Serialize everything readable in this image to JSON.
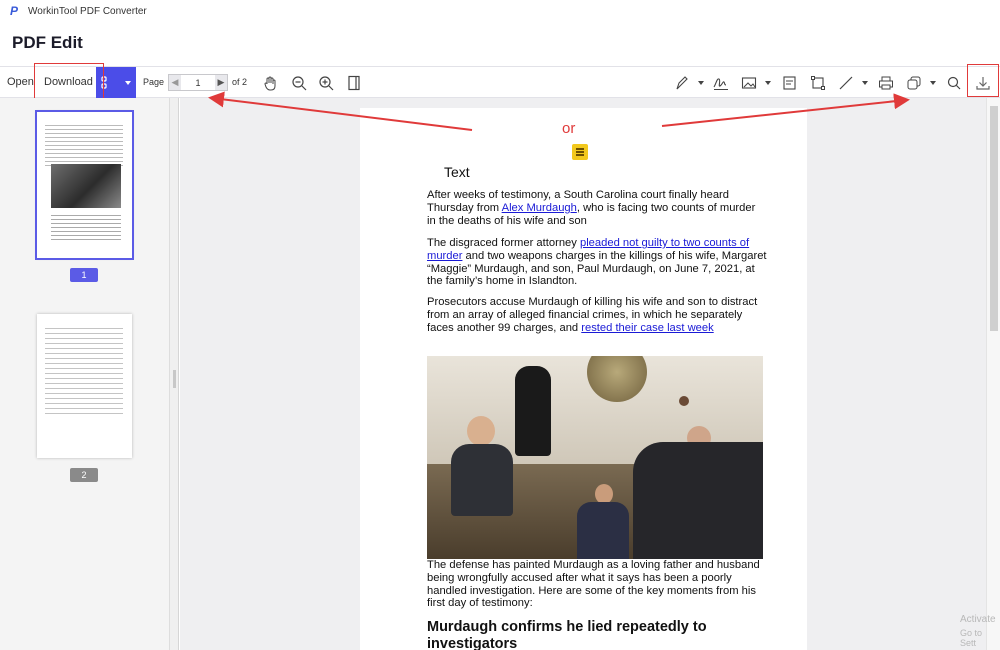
{
  "app": {
    "title": "WorkinTool PDF Converter"
  },
  "header": {
    "title": "PDF Edit"
  },
  "toolbar": {
    "open_label": "Open",
    "download_label": "Download",
    "page_label": "Page",
    "page_value": "1",
    "page_total": "of 2",
    "icons": [
      "hand-icon",
      "zoom-out-icon",
      "zoom-in-icon",
      "single-page-icon",
      "pen-icon",
      "signature-icon",
      "image-icon",
      "form-icon",
      "crop-icon",
      "line-icon",
      "print-icon",
      "stamp-icon",
      "search-icon",
      "download-icon"
    ]
  },
  "annotation": {
    "or_label": "or",
    "accent_color": "#e03a3a"
  },
  "sidebar": {
    "pages": [
      {
        "number": "1",
        "selected": true
      },
      {
        "number": "2",
        "selected": false
      }
    ]
  },
  "document": {
    "text_label": "Text",
    "para1_a": "After weeks of testimony, a South Carolina court finally heard Thursday from ",
    "para1_link": "Alex Murdaugh",
    "para1_b": ", who is facing two counts of murder in the deaths of his wife and son",
    "para2_a": "The disgraced former attorney ",
    "para2_link": "pleaded not guilty to two counts of murder",
    "para2_b": " and two weapons charges in the killings of his wife, Margaret “Maggie” Murdaugh, and son, Paul Murdaugh, on June 7, 2021, at the family’s home in Islandton.",
    "para3_a": "Prosecutors accuse Murdaugh of killing his wife and son to distract from an array of alleged financial crimes, in which he separately faces another 99 charges, and ",
    "para3_link": "rested their case last week",
    "para4": "The defense has painted Murdaugh as a loving father and husband being wrongfully accused after what it says has been a poorly handled investigation. Here are some of the key moments from his first day of testimony:",
    "heading": "Murdaugh confirms he lied repeatedly to investigators"
  },
  "watermark": {
    "line1": "Activate",
    "line2": "Go to Sett"
  }
}
